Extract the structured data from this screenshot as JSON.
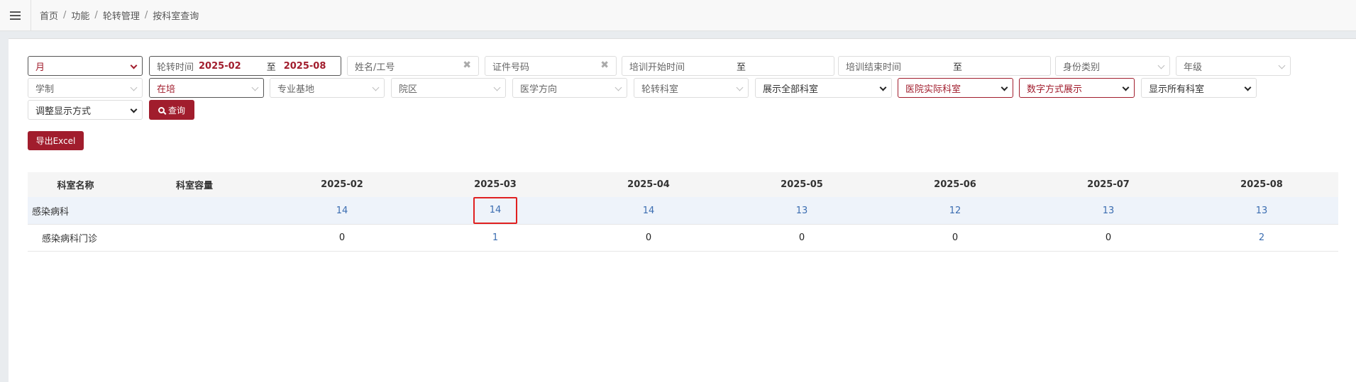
{
  "breadcrumb": [
    "首页",
    "功能",
    "轮转管理",
    "按科室查询"
  ],
  "breadcrumb_sep": "/",
  "accent_color": "#a11d2d",
  "filters": {
    "period_select": "月",
    "rotation_time_label": "轮转时间",
    "rotation_start": "2025-02",
    "range_sep": "至",
    "rotation_end": "2025-08",
    "name_placeholder": "姓名/工号",
    "id_placeholder": "证件号码",
    "train_start_placeholder": "培训开始时间",
    "train_end_placeholder": "培训结束时间",
    "identity_type": "身份类别",
    "grade": "年级",
    "school_system": "学制",
    "status": "在培",
    "major_base": "专业基地",
    "campus": "院区",
    "medical_direction": "医学方向",
    "rotation_dept": "轮转科室",
    "show_all_depts": "展示全部科室",
    "hospital_actual_dept": "医院实际科室",
    "number_display": "数字方式展示",
    "display_all_rooms": "显示所有科室",
    "adjust_display": "调整显示方式",
    "clear_symbol": "✖"
  },
  "buttons": {
    "query": "查询",
    "export": "导出Excel"
  },
  "table": {
    "headers": [
      "科室名称",
      "科室容量",
      "2025-02",
      "2025-03",
      "2025-04",
      "2025-05",
      "2025-06",
      "2025-07",
      "2025-08"
    ],
    "rows": [
      {
        "name": "感染病科",
        "capacity": "",
        "values": [
          "14",
          "14",
          "14",
          "13",
          "12",
          "13",
          "13"
        ]
      },
      {
        "name": "感染病科门诊",
        "capacity": "",
        "values": [
          "0",
          "1",
          "0",
          "0",
          "0",
          "0",
          "2"
        ]
      }
    ]
  }
}
